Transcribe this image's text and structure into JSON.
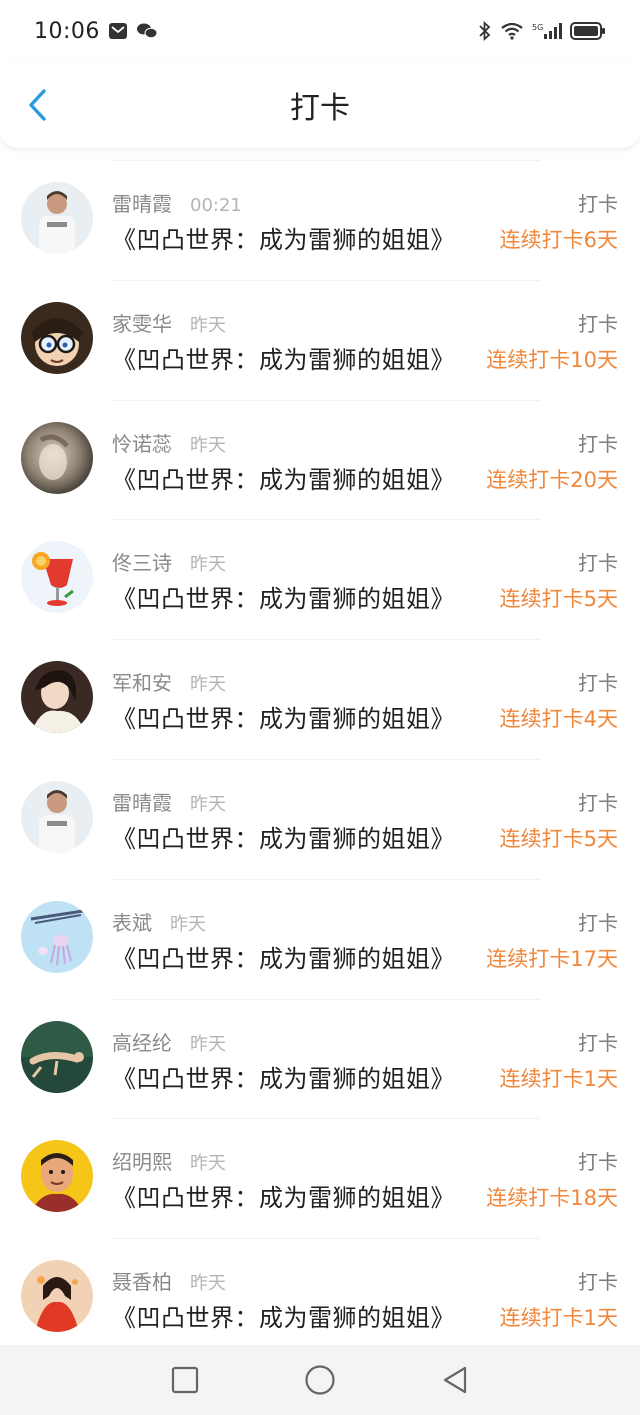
{
  "status_bar": {
    "time": "10:06",
    "network": "5G"
  },
  "header": {
    "title": "打卡",
    "back_icon": "chevron-left-icon"
  },
  "colors": {
    "accent": "#2a9ae0",
    "streak": "#f0873a"
  },
  "list": [
    {
      "name": "雷晴霞",
      "time": "00:21",
      "book": "《凹凸世界：成为雷狮的姐姐》",
      "action": "打卡",
      "streak": "连续打卡6天",
      "avatar": "man-white-shirt"
    },
    {
      "name": "家雯华",
      "time": "昨天",
      "book": "《凹凸世界：成为雷狮的姐姐》",
      "action": "打卡",
      "streak": "连续打卡10天",
      "avatar": "anime-boy-glasses"
    },
    {
      "name": "怜诺蕊",
      "time": "昨天",
      "book": "《凹凸世界：成为雷狮的姐姐》",
      "action": "打卡",
      "streak": "连续打卡20天",
      "avatar": "blurry-woman"
    },
    {
      "name": "佟三诗",
      "time": "昨天",
      "book": "《凹凸世界：成为雷狮的姐姐》",
      "action": "打卡",
      "streak": "连续打卡5天",
      "avatar": "drink-glass"
    },
    {
      "name": "军和安",
      "time": "昨天",
      "book": "《凹凸世界：成为雷狮的姐姐》",
      "action": "打卡",
      "streak": "连续打卡4天",
      "avatar": "woman-portrait"
    },
    {
      "name": "雷晴霞",
      "time": "昨天",
      "book": "《凹凸世界：成为雷狮的姐姐》",
      "action": "打卡",
      "streak": "连续打卡5天",
      "avatar": "man-white-shirt"
    },
    {
      "name": "表斌",
      "time": "昨天",
      "book": "《凹凸世界：成为雷狮的姐姐》",
      "action": "打卡",
      "streak": "连续打卡17天",
      "avatar": "sky-jellyfish"
    },
    {
      "name": "高经纶",
      "time": "昨天",
      "book": "《凹凸世界：成为雷狮的姐姐》",
      "action": "打卡",
      "streak": "连续打卡1天",
      "avatar": "swimmer"
    },
    {
      "name": "绍明熙",
      "time": "昨天",
      "book": "《凹凸世界：成为雷狮的姐姐》",
      "action": "打卡",
      "streak": "连续打卡18天",
      "avatar": "cartoon-man"
    },
    {
      "name": "聂香柏",
      "time": "昨天",
      "book": "《凹凸世界：成为雷狮的姐姐》",
      "action": "打卡",
      "streak": "连续打卡1天",
      "avatar": "girl-red-dress"
    }
  ],
  "navbar": {
    "items": [
      "square-icon",
      "circle-icon",
      "triangle-back-icon"
    ]
  }
}
